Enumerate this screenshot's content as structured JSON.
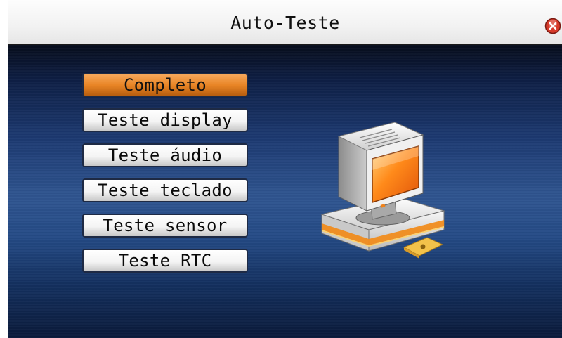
{
  "window": {
    "title": "Auto-Teste"
  },
  "menu": {
    "items": [
      {
        "label": "Completo",
        "selected": true
      },
      {
        "label": "Teste display",
        "selected": false
      },
      {
        "label": "Teste áudio",
        "selected": false
      },
      {
        "label": "Teste teclado",
        "selected": false
      },
      {
        "label": "Teste sensor",
        "selected": false
      },
      {
        "label": "Teste RTC",
        "selected": false
      }
    ]
  },
  "icons": {
    "close": "close-icon",
    "illustration": "computer-icon"
  },
  "colors": {
    "selected_item": "#e98526",
    "background_top": "#070d1c",
    "background_mid": "#2f5590",
    "titlebar": "#f2f2f2",
    "close_button": "#d63a2a"
  }
}
